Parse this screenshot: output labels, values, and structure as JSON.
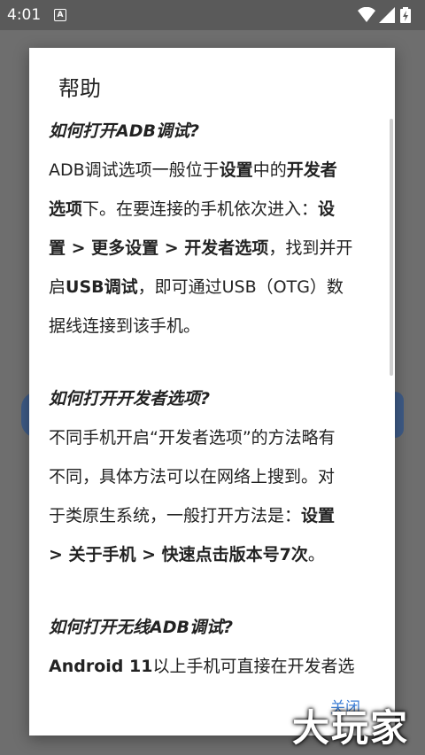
{
  "status_bar": {
    "time": "4:01",
    "notification_glyph": "A",
    "icons": [
      "wifi-icon",
      "signal-icon",
      "battery-charging-icon"
    ]
  },
  "dialog": {
    "title": "帮助",
    "close_label": "关闭",
    "sections": [
      {
        "question": "如何打开ADB调试?",
        "lines": [
          [
            {
              "t": "ADB调试选项一般位于"
            },
            {
              "t": "设置",
              "b": true
            },
            {
              "t": "中的"
            },
            {
              "t": "开发者",
              "b": true
            }
          ],
          [
            {
              "t": "选项",
              "b": true
            },
            {
              "t": "下。在要连接的手机依次进入："
            },
            {
              "t": "设",
              "b": true
            }
          ],
          [
            {
              "t": "置 > 更多设置 > 开发者选项",
              "b": true
            },
            {
              "t": "，找到并开"
            }
          ],
          [
            {
              "t": "启"
            },
            {
              "t": "USB调试",
              "b": true
            },
            {
              "t": "，即可通过USB（OTG）数"
            }
          ],
          [
            {
              "t": "据线连接到该手机。"
            }
          ]
        ]
      },
      {
        "question": "如何打开开发者选项?",
        "lines": [
          [
            {
              "t": "不同手机开启“开发者选项”的方法略有"
            }
          ],
          [
            {
              "t": "不同，具体方法可以在网络上搜到。对"
            }
          ],
          [
            {
              "t": "于类原生系统，一般打开方法是："
            },
            {
              "t": "设置",
              "b": true
            }
          ],
          [
            {
              "t": "> 关于手机 > 快速点击版本号7次",
              "b": true
            },
            {
              "t": "。"
            }
          ]
        ]
      },
      {
        "question": "如何打开无线ADB调试?",
        "lines": [
          [
            {
              "t": "Android 11",
              "b": true
            },
            {
              "t": "以上手机可直接在开发者选"
            }
          ]
        ]
      }
    ]
  },
  "watermark": "大玩家"
}
